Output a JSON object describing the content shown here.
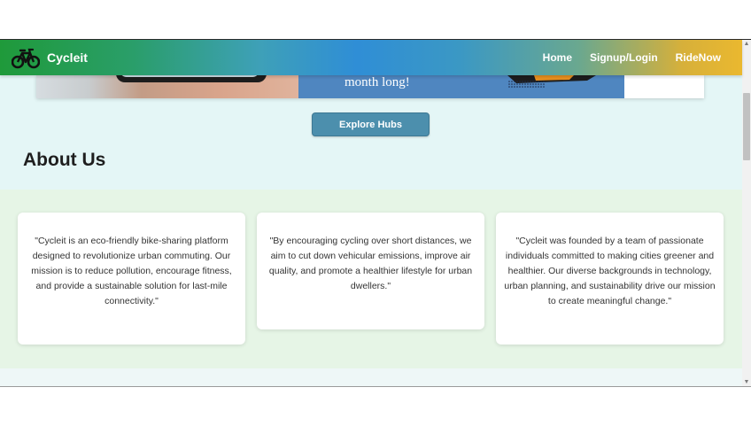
{
  "navbar": {
    "brand": "Cycleit",
    "links": [
      "Home",
      "Signup/Login",
      "RideNow"
    ]
  },
  "hero": {
    "banner_text": "month long!"
  },
  "explore": {
    "label": "Explore Hubs"
  },
  "about": {
    "title": "About Us",
    "cards": [
      "\"Cycleit is an eco-friendly bike-sharing platform designed to revolutionize urban commuting. Our mission is to reduce pollution, encourage fitness, and provide a sustainable solution for last-mile connectivity.\"",
      "\"By encouraging cycling over short distances, we aim to cut down vehicular emissions, improve air quality, and promote a healthier lifestyle for urban dwellers.\"",
      "\"Cycleit was founded by a team of passionate individuals committed to making cities greener and healthier. Our diverse backgrounds in technology, urban planning, and sustainability drive our mission to create meaningful change.\""
    ]
  },
  "colors": {
    "accent_button": "#4c8fad",
    "about_background": "#e6f5e6",
    "page_background": "#e4f6f6"
  },
  "icons": {
    "brand": "bicycle-icon",
    "scroll_up": "triangle-up-icon",
    "scroll_down": "triangle-down-icon"
  }
}
